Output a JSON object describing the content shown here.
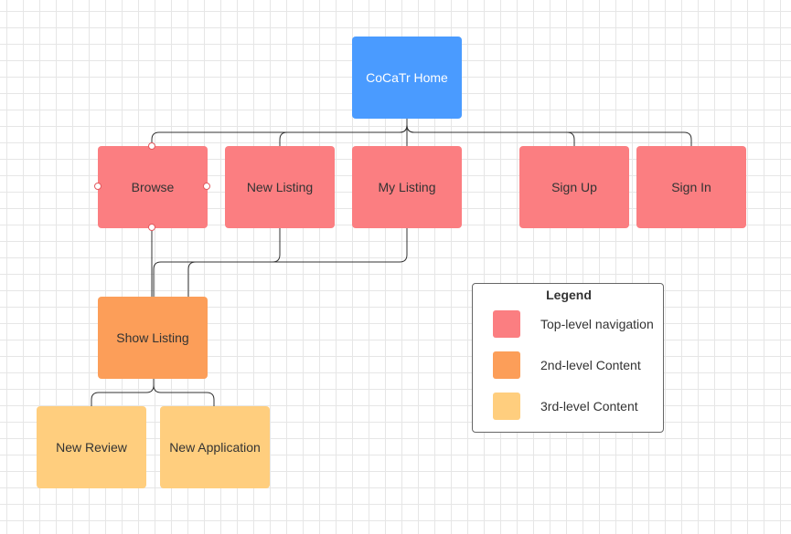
{
  "colors": {
    "home": "#4a9bff",
    "top_level": "#fb7e81",
    "second_level": "#fc9e59",
    "third_level": "#ffce7e",
    "connector": "#333333",
    "grid": "#e6e6e6"
  },
  "nodes": {
    "home": "CoCaTr Home",
    "browse": "Browse",
    "new_listing": "New Listing",
    "my_listing": "My Listing",
    "sign_up": "Sign Up",
    "sign_in": "Sign In",
    "show_listing": "Show Listing",
    "new_review": "New Review",
    "new_application": "New Application"
  },
  "legend": {
    "title": "Legend",
    "items": [
      {
        "label": "Top-level navigation",
        "color": "#fb7e81"
      },
      {
        "label": "2nd-level Content",
        "color": "#fc9e59"
      },
      {
        "label": "3rd-level Content",
        "color": "#ffce7e"
      }
    ]
  }
}
